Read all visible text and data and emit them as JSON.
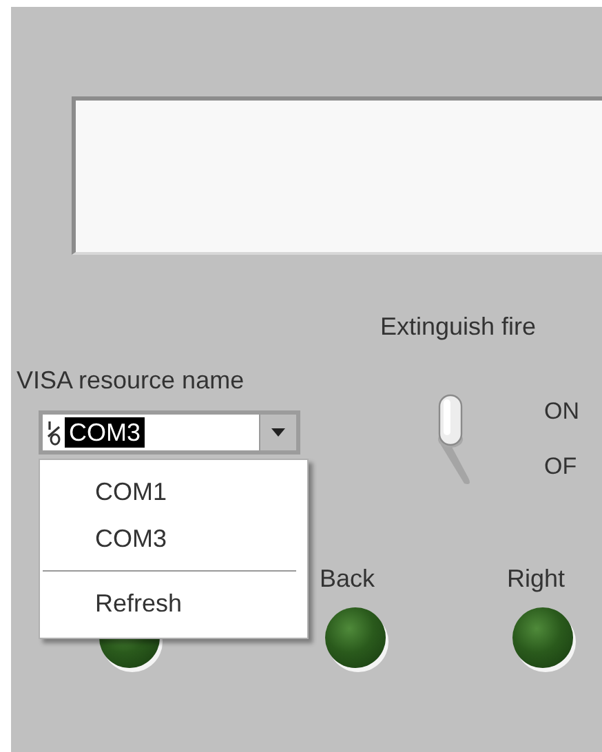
{
  "string_display": {
    "kind": "string_indicator"
  },
  "switch": {
    "label": "Extinguish fire",
    "on_text": "ON",
    "off_text": "OF",
    "on": true
  },
  "visa_resource": {
    "label": "VISA resource name",
    "value": "COM3",
    "text_selected": true,
    "expanded": true
  },
  "dropdown_menu": [
    {
      "kind": "item",
      "label": "COM1"
    },
    {
      "kind": "item",
      "label": "COM3"
    },
    {
      "kind": "separator"
    },
    {
      "kind": "item",
      "label": "Refresh"
    }
  ],
  "leds": [
    {
      "on": false
    },
    {
      "label": "Back",
      "on": false
    },
    {
      "label": "Right",
      "on": false
    }
  ]
}
